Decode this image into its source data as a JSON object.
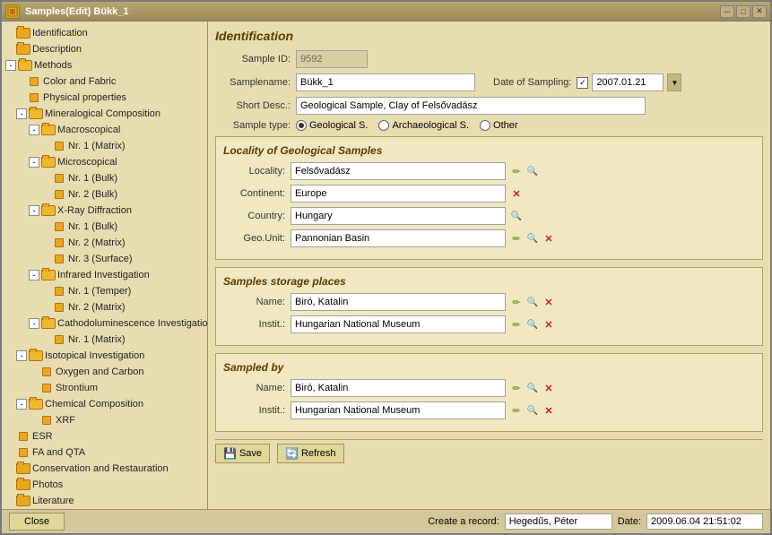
{
  "window": {
    "title": "Samples(Edit)  Bükk_1",
    "min_btn": "─",
    "max_btn": "□",
    "close_btn": "✕"
  },
  "tree": {
    "items": [
      {
        "id": "identification",
        "label": "Identification",
        "level": 0,
        "type": "leaf",
        "expand": null
      },
      {
        "id": "description",
        "label": "Description",
        "level": 0,
        "type": "leaf",
        "expand": null
      },
      {
        "id": "methods",
        "label": "Methods",
        "level": 0,
        "type": "folder",
        "expand": "minus"
      },
      {
        "id": "color-fabric",
        "label": "Color and Fabric",
        "level": 1,
        "type": "leaf",
        "expand": null
      },
      {
        "id": "physical",
        "label": "Physical properties",
        "level": 1,
        "type": "leaf",
        "expand": null
      },
      {
        "id": "mineralogical",
        "label": "Mineralogical Composition",
        "level": 1,
        "type": "folder",
        "expand": "minus"
      },
      {
        "id": "macroscopical",
        "label": "Macroscopical",
        "level": 2,
        "type": "folder",
        "expand": "minus"
      },
      {
        "id": "nr1-matrix",
        "label": "Nr. 1 (Matrix)",
        "level": 3,
        "type": "leaf",
        "expand": null
      },
      {
        "id": "microscopical",
        "label": "Microscopical",
        "level": 2,
        "type": "folder",
        "expand": "minus"
      },
      {
        "id": "nr1-bulk",
        "label": "Nr. 1 (Bulk)",
        "level": 3,
        "type": "leaf",
        "expand": null
      },
      {
        "id": "nr2-bulk",
        "label": "Nr. 2 (Bulk)",
        "level": 3,
        "type": "leaf",
        "expand": null
      },
      {
        "id": "xray",
        "label": "X-Ray Diffraction",
        "level": 2,
        "type": "folder",
        "expand": "minus"
      },
      {
        "id": "nr1-bulk2",
        "label": "Nr. 1 (Bulk)",
        "level": 3,
        "type": "leaf",
        "expand": null
      },
      {
        "id": "nr2-matrix2",
        "label": "Nr. 2 (Matrix)",
        "level": 3,
        "type": "leaf",
        "expand": null
      },
      {
        "id": "nr3-surface",
        "label": "Nr. 3 (Surface)",
        "level": 3,
        "type": "leaf",
        "expand": null
      },
      {
        "id": "infrared",
        "label": "Infrared Investigation",
        "level": 2,
        "type": "folder",
        "expand": "minus"
      },
      {
        "id": "nr1-temper",
        "label": "Nr. 1 (Temper)",
        "level": 3,
        "type": "leaf",
        "expand": null
      },
      {
        "id": "nr2-matrix3",
        "label": "Nr. 2 (Matrix)",
        "level": 3,
        "type": "leaf",
        "expand": null
      },
      {
        "id": "cathodolum",
        "label": "Cathodoluminescence Investigation",
        "level": 2,
        "type": "folder",
        "expand": "minus"
      },
      {
        "id": "nr1-matrix4",
        "label": "Nr. 1 (Matrix)",
        "level": 3,
        "type": "leaf",
        "expand": null
      },
      {
        "id": "isotopical",
        "label": "Isotopical Investigation",
        "level": 1,
        "type": "folder",
        "expand": "minus"
      },
      {
        "id": "oxygen-carbon",
        "label": "Oxygen and Carbon",
        "level": 2,
        "type": "leaf",
        "expand": null
      },
      {
        "id": "strontium",
        "label": "Strontium",
        "level": 2,
        "type": "leaf",
        "expand": null
      },
      {
        "id": "chemical",
        "label": "Chemical Composition",
        "level": 1,
        "type": "folder",
        "expand": "minus"
      },
      {
        "id": "xrf",
        "label": "XRF",
        "level": 2,
        "type": "leaf",
        "expand": null
      },
      {
        "id": "esr",
        "label": "ESR",
        "level": 0,
        "type": "leaf",
        "expand": null
      },
      {
        "id": "fa-qta",
        "label": "FA and QTA",
        "level": 0,
        "type": "leaf",
        "expand": null
      },
      {
        "id": "conservation",
        "label": "Conservation and Restauration",
        "level": 0,
        "type": "leaf",
        "expand": null
      },
      {
        "id": "photos",
        "label": "Photos",
        "level": 0,
        "type": "leaf",
        "expand": null
      },
      {
        "id": "literature",
        "label": "Literature",
        "level": 0,
        "type": "leaf",
        "expand": null
      }
    ]
  },
  "form": {
    "section_title": "Identification",
    "sample_id_label": "Sample ID:",
    "sample_id_value": "9592",
    "samplename_label": "Samplename:",
    "samplename_value": "Bükk_1",
    "date_label": "Date of Sampling:",
    "date_value": "2007.01.21",
    "shortdesc_label": "Short Desc.:",
    "shortdesc_value": "Geological Sample, Clay of Felsővadász",
    "sampletype_label": "Sample type:",
    "sampletype_options": [
      {
        "id": "geological",
        "label": "Geological S.",
        "selected": true
      },
      {
        "id": "archaeological",
        "label": "Archaeological S.",
        "selected": false
      },
      {
        "id": "other",
        "label": "Other",
        "selected": false
      }
    ],
    "locality_section": {
      "title": "Locality of Geological Samples",
      "fields": [
        {
          "label": "Locality:",
          "value": "Felsővadász",
          "icons": [
            "pencil",
            "search"
          ]
        },
        {
          "label": "Continent:",
          "value": "Europe",
          "icons": [
            "x"
          ]
        },
        {
          "label": "Country:",
          "value": "Hungary",
          "icons": [
            "search"
          ]
        },
        {
          "label": "Geo.Unit:",
          "value": "Pannonian Basin",
          "icons": [
            "pencil",
            "search",
            "x"
          ]
        }
      ]
    },
    "storage_section": {
      "title": "Samples storage places",
      "fields": [
        {
          "label": "Name:",
          "value": "Biró, Katalin",
          "icons": [
            "pencil",
            "search",
            "x"
          ]
        },
        {
          "label": "Instit.:",
          "value": "Hungarian National Museum",
          "icons": [
            "pencil",
            "search",
            "x"
          ]
        }
      ]
    },
    "sampled_section": {
      "title": "Sampled by",
      "fields": [
        {
          "label": "Name:",
          "value": "Biró, Katalin",
          "icons": [
            "pencil",
            "search",
            "x"
          ]
        },
        {
          "label": "Instit.:",
          "value": "Hungarian National Museum",
          "icons": [
            "pencil",
            "search",
            "x"
          ]
        }
      ]
    }
  },
  "toolbar": {
    "save_label": "Save",
    "refresh_label": "Refresh"
  },
  "statusbar": {
    "close_label": "Close",
    "create_label": "Create a record:",
    "creator_value": "Hegedűs, Péter",
    "date_label": "Date:",
    "date_value": "2009.06.04 21:51:02"
  }
}
